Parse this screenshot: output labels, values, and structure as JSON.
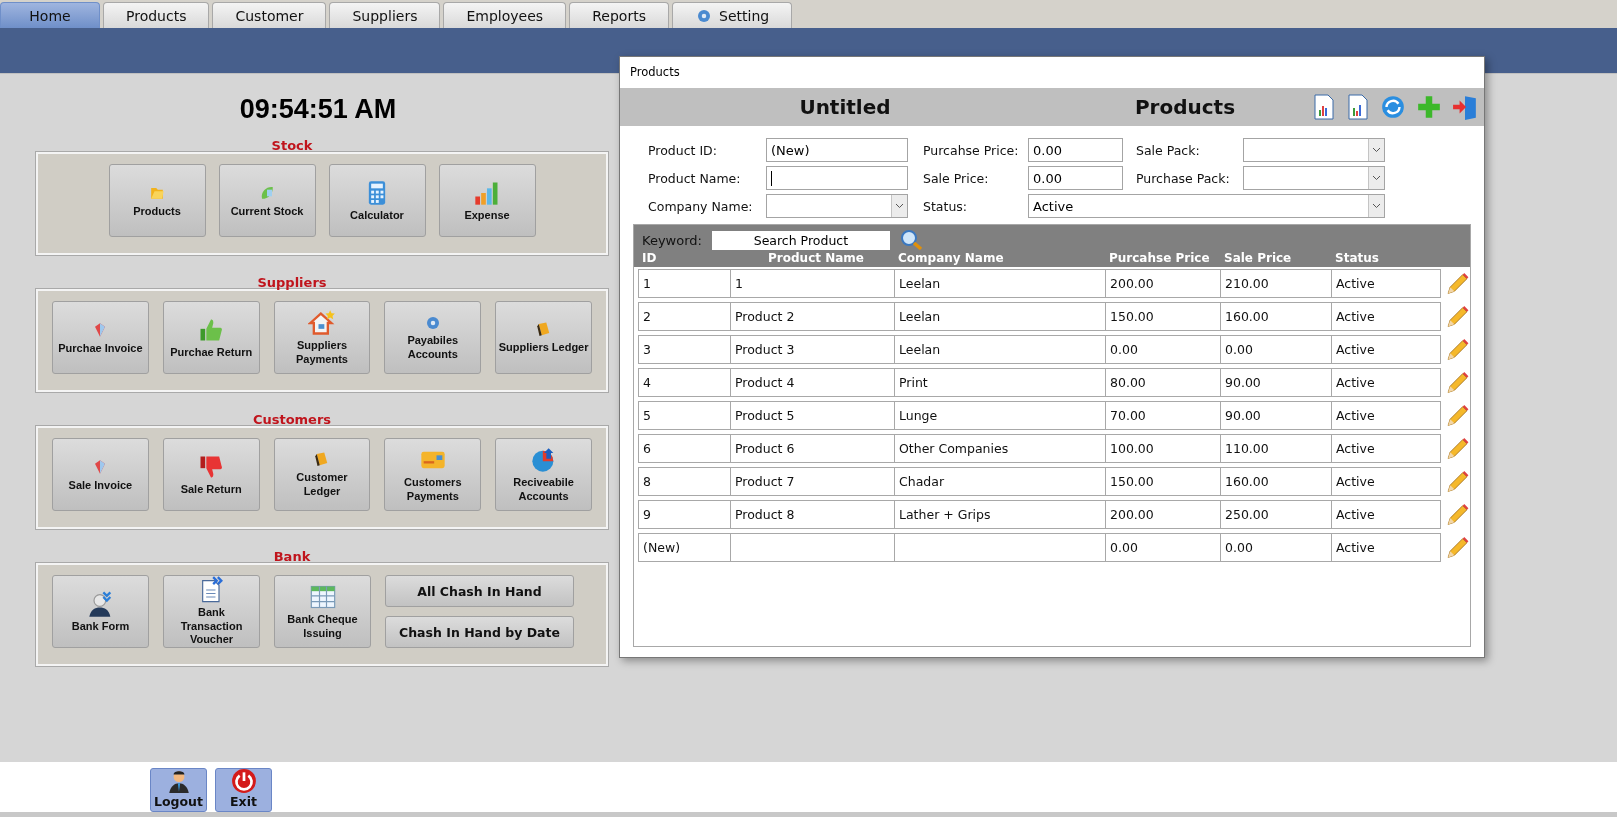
{
  "tabs": [
    {
      "label": "Home",
      "selected": true,
      "kind": "plain"
    },
    {
      "label": "Products",
      "selected": false,
      "kind": "plain"
    },
    {
      "label": "Customer",
      "selected": false,
      "kind": "plain"
    },
    {
      "label": "Suppliers",
      "selected": false,
      "kind": "plain"
    },
    {
      "label": "Employees",
      "selected": false,
      "kind": "plain"
    },
    {
      "label": "Reports",
      "selected": false,
      "kind": "plain"
    },
    {
      "label": "Setting",
      "selected": false,
      "kind": "gear"
    }
  ],
  "clock": "09:54:51 AM",
  "groups": [
    {
      "title": "Stock",
      "buttons": [
        {
          "label": "Products",
          "kind": "tile"
        },
        {
          "label": "Current Stock",
          "kind": "tile"
        },
        {
          "label": "Calculator",
          "kind": "tile"
        },
        {
          "label": "Expense",
          "kind": "tile"
        }
      ]
    },
    {
      "title": "Suppliers",
      "buttons": [
        {
          "label": "Purchae Invoice",
          "kind": "tile"
        },
        {
          "label": "Purchae Return",
          "kind": "tile"
        },
        {
          "label": "Suppliers Payments",
          "kind": "tile"
        },
        {
          "label": "Payabiles Accounts",
          "kind": "tile"
        },
        {
          "label": "Suppliers Ledger",
          "kind": "tile"
        }
      ]
    },
    {
      "title": "Customers",
      "buttons": [
        {
          "label": "Sale Invoice",
          "kind": "tile"
        },
        {
          "label": "Sale Return",
          "kind": "tile"
        },
        {
          "label": "Customer Ledger",
          "kind": "tile"
        },
        {
          "label": "Customers Payments",
          "kind": "tile"
        },
        {
          "label": "Reciveabile Accounts",
          "kind": "tile"
        }
      ]
    },
    {
      "title": "Bank",
      "buttons": [
        {
          "label": "Bank Form",
          "kind": "tile"
        },
        {
          "label": "Bank Transaction Voucher",
          "kind": "tile"
        },
        {
          "label": "Bank Cheque Issuing",
          "kind": "tile"
        },
        {
          "label": "All Chash In Hand",
          "kind": "wide"
        },
        {
          "label": "Chash In Hand by Date",
          "kind": "wide"
        }
      ]
    }
  ],
  "dialog": {
    "title": "Products",
    "header_left": "Untitled",
    "header_right": "Products",
    "form": [
      [
        {
          "label": "Product ID:",
          "value": "(New)",
          "kind": "text"
        },
        {
          "label": "Purcahse Price:",
          "value": "0.00",
          "kind": "text"
        },
        {
          "label": "Sale Pack:",
          "kind": "combo"
        }
      ],
      [
        {
          "label": "Product Name:",
          "kind": "text",
          "focused": true
        },
        {
          "label": "Sale Price:",
          "value": "0.00",
          "kind": "text"
        },
        {
          "label": "Purchase Pack:",
          "kind": "combo"
        }
      ],
      [
        {
          "label": "Company Name:",
          "kind": "combo"
        },
        {
          "label": "Status:",
          "value": "Active",
          "kind": "combo"
        }
      ]
    ],
    "keyword_label": "Keyword:",
    "search_value": "Search Product",
    "columns": [
      "ID",
      "Product Name",
      "Company Name",
      "Purcahse Price",
      "Sale Price",
      "Status"
    ],
    "rows": [
      [
        "1",
        "1",
        "Leelan",
        "200.00",
        "210.00",
        "Active"
      ],
      [
        "2",
        "Product 2",
        "Leelan",
        "150.00",
        "160.00",
        "Active"
      ],
      [
        "3",
        "Product 3",
        "Leelan",
        "0.00",
        "0.00",
        "Active"
      ],
      [
        "4",
        "Product 4",
        "Print",
        "80.00",
        "90.00",
        "Active"
      ],
      [
        "5",
        "Product 5",
        "Lunge",
        "70.00",
        "90.00",
        "Active"
      ],
      [
        "6",
        "Product 6",
        "Other Companies",
        "100.00",
        "110.00",
        "Active"
      ],
      [
        "8",
        "Product 7",
        "Chadar",
        "150.00",
        "160.00",
        "Active"
      ],
      [
        "9",
        "Product 8",
        "Lather + Grips",
        "200.00",
        "250.00",
        "Active"
      ],
      [
        "(New)",
        "",
        "",
        "0.00",
        "0.00",
        "Active"
      ]
    ]
  },
  "bottom_buttons": [
    {
      "label": "Logout"
    },
    {
      "label": "Exit"
    }
  ]
}
